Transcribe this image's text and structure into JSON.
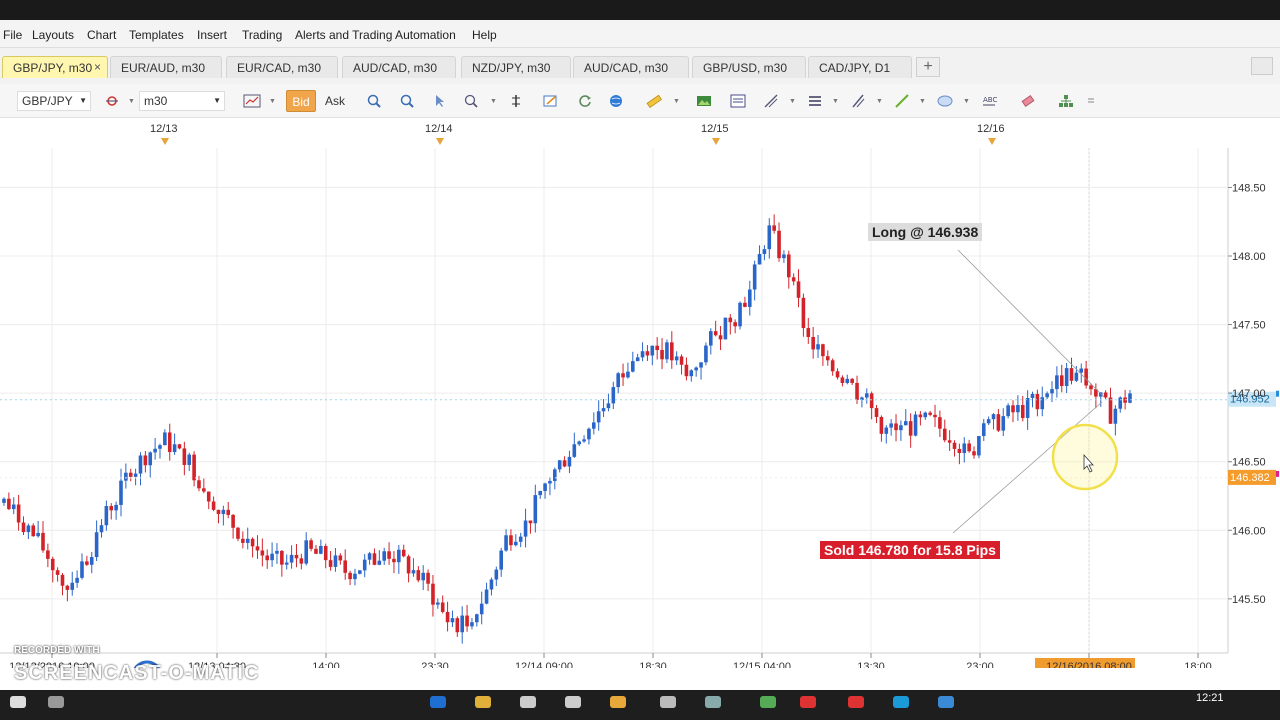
{
  "menu": [
    "File",
    "Layouts",
    "Chart",
    "Templates",
    "Insert",
    "Trading",
    "Alerts and Trading Automation",
    "Help"
  ],
  "tabs": [
    {
      "label": "GBP/JPY, m30",
      "active": true,
      "close": "×"
    },
    {
      "label": "EUR/AUD, m30"
    },
    {
      "label": "EUR/CAD, m30"
    },
    {
      "label": "AUD/CAD, m30"
    },
    {
      "label": "NZD/JPY, m30"
    },
    {
      "label": "AUD/CAD, m30"
    },
    {
      "label": "GBP/USD, m30"
    },
    {
      "label": "CAD/JPY, D1"
    }
  ],
  "add_tab": "+",
  "toolbar": {
    "symbol": "GBP/JPY",
    "timeframe": "m30",
    "bid": "Bid",
    "ask": "Ask"
  },
  "icons": [
    "line-tool-icon",
    "crosshair-icon",
    "zoom-icon",
    "indicator-icon",
    "draw-icon",
    "refresh-icon",
    "globe-icon",
    "ruler-icon",
    "image-icon",
    "template-icon",
    "fib-icon",
    "layers-icon",
    "pen-icon",
    "shape-icon",
    "text-icon",
    "eraser-icon",
    "hierarchy-icon"
  ],
  "date_header": [
    "12/13",
    "12/14",
    "12/15",
    "12/16"
  ],
  "chart_data": {
    "type": "candlestick",
    "symbol": "GBP/JPY",
    "timeframe": "m30",
    "ylim": [
      145.2,
      148.7
    ],
    "y_ticks": [
      "148.50",
      "148.00",
      "147.50",
      "147.00",
      "146.50",
      "146.00",
      "145.50"
    ],
    "x_ticks": [
      "12/12/2016 19:00",
      "12/13 04:30",
      "14:00",
      "23:30",
      "12/14 09:00",
      "18:30",
      "12/15 04:00",
      "13:30",
      "23:00",
      "12/16/2016 08:00",
      "18:00"
    ],
    "current_price": "146.952",
    "secondary_price": "146.382",
    "annotations": {
      "long": "Long @ 146.938",
      "sold": "Sold 146.780 for 15.8 Pips"
    },
    "colors": {
      "up": "#2a66c9",
      "down": "#d3232a"
    },
    "anchors": [
      146.2,
      146.05,
      145.85,
      145.6,
      145.75,
      146.1,
      146.35,
      146.55,
      146.65,
      146.55,
      146.3,
      146.1,
      145.95,
      145.8,
      145.75,
      145.85,
      145.8,
      145.7,
      145.75,
      145.85,
      145.75,
      145.6,
      145.35,
      145.3,
      145.55,
      145.95,
      146.05,
      146.35,
      146.55,
      146.75,
      146.95,
      147.2,
      147.35,
      147.3,
      147.1,
      147.35,
      147.55,
      147.7,
      148.2,
      147.9,
      147.4,
      147.2,
      147.1,
      146.9,
      146.7,
      146.75,
      146.8,
      146.7,
      146.6,
      146.75,
      146.85,
      146.9,
      147.05,
      147.15,
      147.05,
      146.85,
      147.0
    ],
    "candle_count": 232
  },
  "watermark": {
    "line1": "RECORDED WITH",
    "line2": "SCREENCAST-O-MATIC"
  },
  "taskbar": {
    "time": "12:21"
  }
}
